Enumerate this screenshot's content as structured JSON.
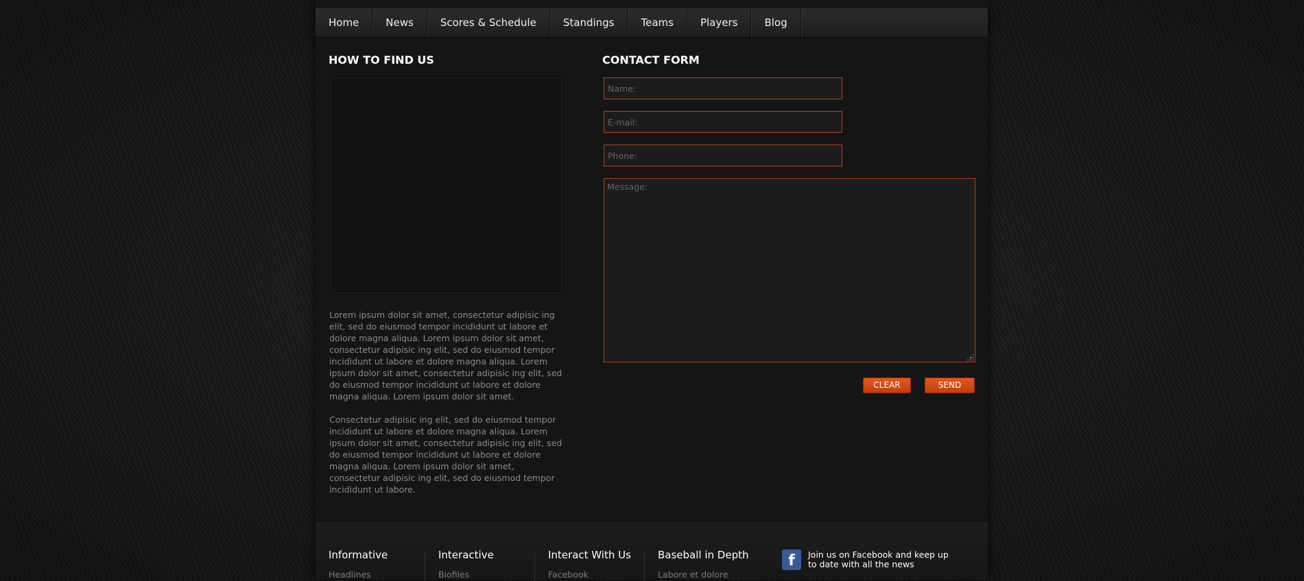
{
  "nav": {
    "items": [
      {
        "label": "Home"
      },
      {
        "label": "News"
      },
      {
        "label": "Scores & Schedule"
      },
      {
        "label": "Standings"
      },
      {
        "label": "Teams"
      },
      {
        "label": "Players"
      },
      {
        "label": "Blog"
      }
    ]
  },
  "find_us": {
    "title": "HOW TO FIND US",
    "paragraph1": "Lorem ipsum dolor sit amet, consectetur adipisic ing elit, sed do eiusmod tempor incididunt ut labore et dolore magna aliqua. Lorem ipsum dolor sit amet, consectetur adipisic ing elit, sed do eiusmod tempor incididunt ut labore et dolore magna aliqua. Lorem ipsum dolor sit amet, consectetur adipisic ing elit, sed do eiusmod tempor incididunt ut labore et dolore magna aliqua. Lorem ipsum dolor sit amet.",
    "paragraph2": "Consectetur adipisic ing elit, sed do eiusmod tempor incididunt ut labore et dolore magna aliqua. Lorem ipsum dolor sit amet, consectetur adipisic ing elit, sed do eiusmod tempor incididunt ut labore et dolore magna aliqua. Lorem ipsum dolor sit amet, consectetur adipisic ing elit, sed do eiusmod tempor incididunt ut labore."
  },
  "contact": {
    "title": "CONTACT FORM",
    "name_placeholder": "Name:",
    "email_placeholder": "E-mail:",
    "phone_placeholder": "Phone:",
    "message_placeholder": "Message:",
    "clear_label": "CLEAR",
    "send_label": "SEND"
  },
  "footer": {
    "columns": [
      {
        "heading": "Informative",
        "link": "Headlines"
      },
      {
        "heading": "Interactive",
        "link": "Biofiles"
      },
      {
        "heading": "Interact With Us",
        "link": "Facebook"
      },
      {
        "heading": "Baseball in Depth",
        "link": "Labore et dolore"
      }
    ],
    "facebook_icon_text": "f",
    "facebook_text": "Join us on Facebook and keep up to date with all the news"
  },
  "colors": {
    "accent": "#e0561c",
    "field_border": "#b0431a",
    "facebook": "#3b5998"
  },
  "icons": {
    "facebook": "facebook-icon",
    "resize": "resize-grip-icon"
  }
}
